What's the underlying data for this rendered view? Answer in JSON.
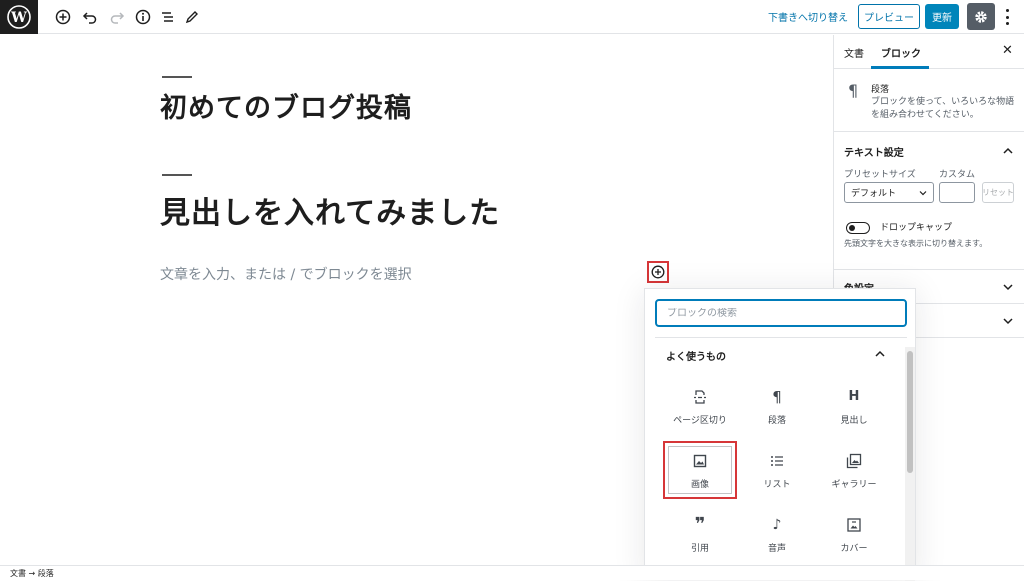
{
  "toolbar": {
    "switch_to_draft": "下書きへ切り替え",
    "preview": "プレビュー",
    "update": "更新"
  },
  "editor": {
    "post_title": "初めてのブログ投稿",
    "heading": "見出しを入れてみました",
    "paragraph_placeholder": "文章を入力、または / でブロックを選択"
  },
  "inserter": {
    "search_placeholder": "ブロックの検索",
    "panel_title": "よく使うもの",
    "blocks": [
      {
        "label": "ページ区切り",
        "icon": "page-break-icon"
      },
      {
        "label": "段落",
        "icon": "paragraph-icon"
      },
      {
        "label": "見出し",
        "icon": "heading-icon"
      },
      {
        "label": "画像",
        "icon": "image-icon"
      },
      {
        "label": "リスト",
        "icon": "list-icon"
      },
      {
        "label": "ギャラリー",
        "icon": "gallery-icon"
      },
      {
        "label": "引用",
        "icon": "quote-icon"
      },
      {
        "label": "音声",
        "icon": "audio-icon"
      },
      {
        "label": "カバー",
        "icon": "cover-icon"
      }
    ]
  },
  "sidebar": {
    "tabs": [
      "文書",
      "ブロック"
    ],
    "active_tab": "ブロック",
    "block_card": {
      "name": "段落",
      "description": "ブロックを使って、いろいろな物語を組み合わせてください。"
    },
    "text_settings": {
      "title": "テキスト設定",
      "preset_label": "プリセットサイズ",
      "custom_label": "カスタム",
      "preset_value": "デフォルト",
      "reset": "リセット",
      "dropcap_label": "ドロップキャップ",
      "dropcap_help": "先頭文字を大きな表示に切り替えます。"
    },
    "color_settings_title": "色設定"
  },
  "footer": {
    "breadcrumb": "文書 → 段落"
  },
  "colors": {
    "accent": "#007cba",
    "highlight": "#d63638"
  }
}
